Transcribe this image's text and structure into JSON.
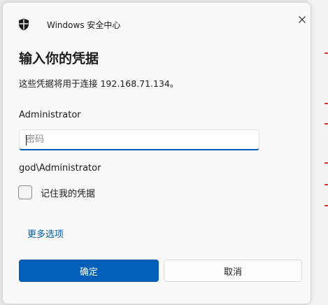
{
  "window": {
    "app_title": "Windows 安全中心",
    "app_icon": "shield-icon",
    "close_icon": "close-icon"
  },
  "dialog": {
    "heading": "输入你的凭据",
    "subtext": "这些凭据将用于连接 192.168.71.134。",
    "username": "Administrator",
    "password_placeholder": "密码",
    "password_value": "",
    "domain_user": "god\\Administrator",
    "remember_label": "记住我的凭据",
    "remember_checked": false,
    "more_options": "更多选项",
    "ok_label": "确定",
    "cancel_label": "取消"
  },
  "colors": {
    "accent": "#005fb8",
    "dialog_background": "#f9f9f9",
    "text": "#1b1b1b"
  }
}
